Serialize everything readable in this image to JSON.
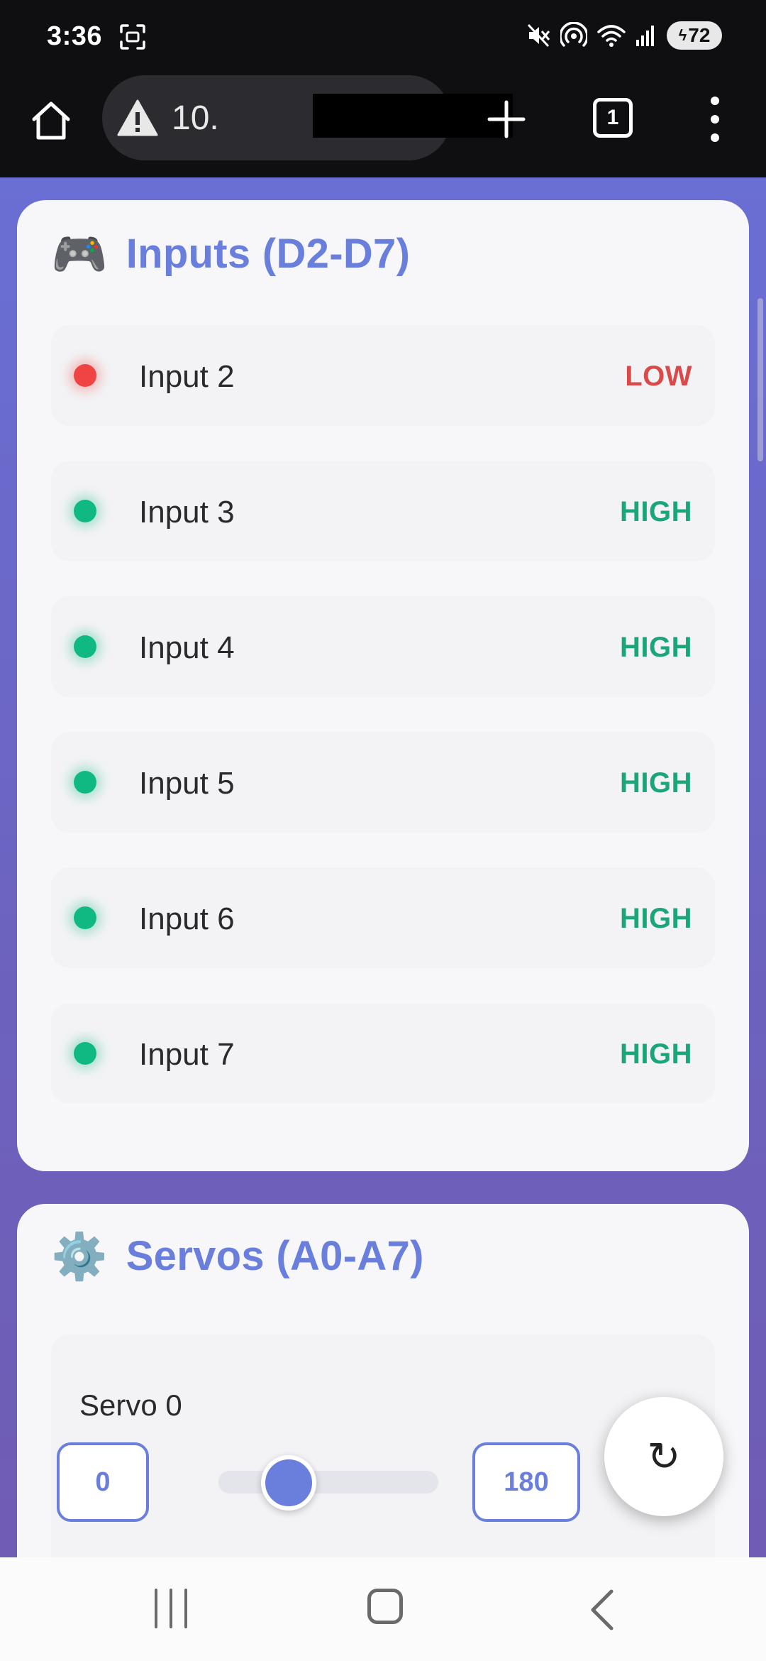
{
  "status_bar": {
    "time": "3:36",
    "battery": "72",
    "icons": [
      "screenshot-icon",
      "mute-icon",
      "hotspot-icon",
      "wifi-icon",
      "signal-icon",
      "battery-icon"
    ]
  },
  "browser": {
    "url_prefix": "10.",
    "tab_count": "1",
    "icons": [
      "home-icon",
      "warning-icon",
      "plus-icon",
      "tabs-icon",
      "more-vert-icon"
    ]
  },
  "inputs_card": {
    "emoji": "🎮",
    "title": "Inputs (D2-D7)",
    "rows": [
      {
        "label": "Input 2",
        "state": "LOW"
      },
      {
        "label": "Input 3",
        "state": "HIGH"
      },
      {
        "label": "Input 4",
        "state": "HIGH"
      },
      {
        "label": "Input 5",
        "state": "HIGH"
      },
      {
        "label": "Input 6",
        "state": "HIGH"
      },
      {
        "label": "Input 7",
        "state": "HIGH"
      }
    ]
  },
  "servos_card": {
    "emoji": "⚙️",
    "title": "Servos (A0-A7)",
    "servo": {
      "label": "Servo 0",
      "min": "0",
      "max": "180",
      "slider_fraction": 0.32
    }
  },
  "fab": {
    "symbol": "↻",
    "icon": "refresh-icon"
  },
  "colors": {
    "accent": "#6a7fdc",
    "low": "#d94a4a",
    "high": "#1aa57a",
    "page_gradient_top": "#6a6fd4",
    "page_gradient_bottom": "#705cb3"
  }
}
